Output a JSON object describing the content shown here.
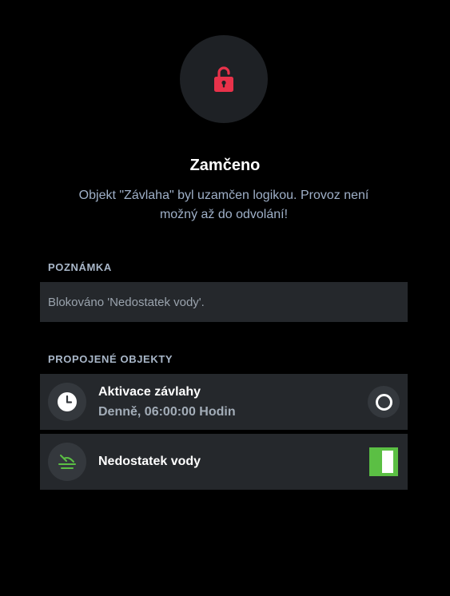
{
  "header": {
    "icon": "lock-icon",
    "title": "Zamčeno",
    "message_line1": "Objekt \"Závlaha\" byl uzamčen logikou. Provoz není",
    "message_line2": "možný až do odvolání!"
  },
  "note": {
    "label": "POZNÁMKA",
    "text": "Blokováno 'Nedostatek vody'."
  },
  "linked": {
    "label": "PROPOJENÉ OBJEKTY",
    "items": [
      {
        "icon": "clock-icon",
        "title": "Aktivace závlahy",
        "subtitle": "Denně, 06:00:00 Hodin",
        "state": "inactive"
      },
      {
        "icon": "water-shortage-icon",
        "title": "Nedostatek vody",
        "state": "on"
      }
    ]
  },
  "colors": {
    "background": "#000000",
    "card": "#25282c",
    "lock_red": "#e8324a",
    "toggle_green": "#5bbf44",
    "accent_text": "#9fb0c8"
  }
}
